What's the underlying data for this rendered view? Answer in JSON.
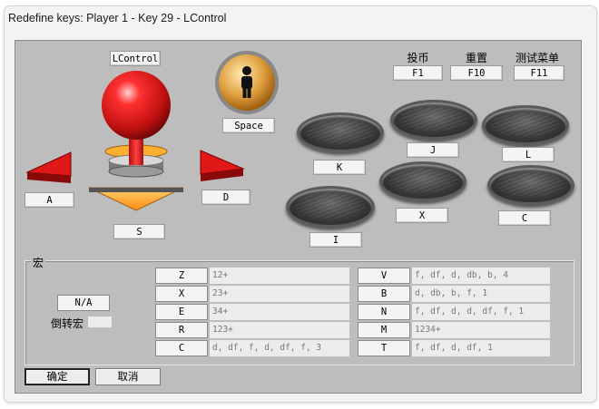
{
  "window": {
    "title": "Redefine keys: Player 1 - Key 29 - LControl"
  },
  "joystick": {
    "top_label": "LControl",
    "left_label": "A",
    "right_label": "D",
    "down_label": "S",
    "colors": {
      "ball": "#e02020",
      "base": "#ff9a20",
      "arrow": "#e01818"
    }
  },
  "coin_button": {
    "label": "Space",
    "icon": "person-icon"
  },
  "system_keys": [
    {
      "caption": "投币",
      "key": "F1"
    },
    {
      "caption": "重置",
      "key": "F10"
    },
    {
      "caption": "测试菜单",
      "key": "F11"
    }
  ],
  "buttons": {
    "K": "K",
    "J": "J",
    "L": "L",
    "I": "I",
    "X": "X",
    "C": "C"
  },
  "macro": {
    "title": "宏",
    "reverse_value": "N/A",
    "reverse_caption": "倒转宏",
    "reverse_field": "",
    "left": [
      {
        "key": "Z",
        "value": "12+"
      },
      {
        "key": "X",
        "value": "23+"
      },
      {
        "key": "E",
        "value": "34+"
      },
      {
        "key": "R",
        "value": "123+"
      },
      {
        "key": "C",
        "value": "d, df, f, d, df, f, 3"
      }
    ],
    "right": [
      {
        "key": "V",
        "value": "f, df, d, db, b, 4"
      },
      {
        "key": "B",
        "value": "d, db, b, f, 1"
      },
      {
        "key": "N",
        "value": "f, df, d, d, df, f, 1"
      },
      {
        "key": "M",
        "value": "1234+"
      },
      {
        "key": "T",
        "value": "f, df, d, df, 1"
      }
    ]
  },
  "footer": {
    "ok": "确定",
    "cancel": "取消"
  }
}
